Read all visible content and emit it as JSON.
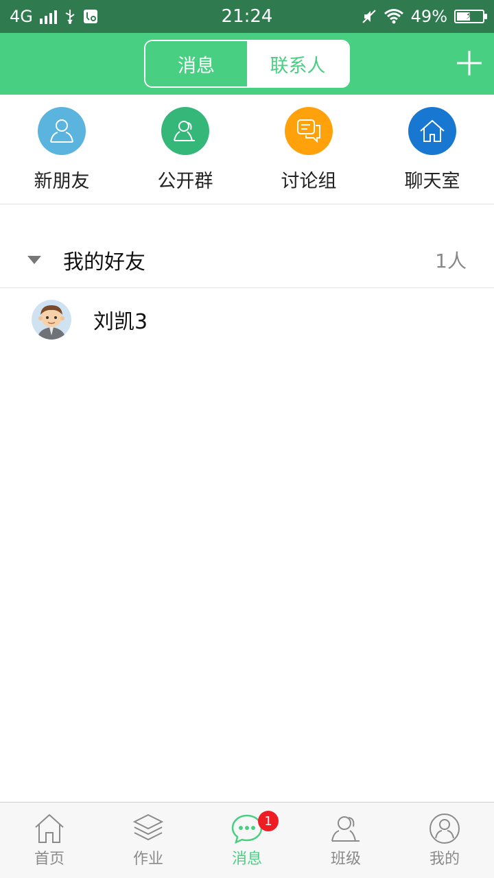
{
  "status_bar": {
    "network": "4G",
    "time": "21:24",
    "battery": "49%"
  },
  "header": {
    "tabs": [
      {
        "label": "消息",
        "selected": false
      },
      {
        "label": "联系人",
        "selected": true
      }
    ],
    "add_icon": "plus-icon"
  },
  "quick_entries": [
    {
      "label": "新朋友",
      "icon": "new-friend-icon",
      "color": "#5bb4de"
    },
    {
      "label": "公开群",
      "icon": "public-group-icon",
      "color": "#35b77a"
    },
    {
      "label": "讨论组",
      "icon": "discussion-icon",
      "color": "#ffa10a"
    },
    {
      "label": "聊天室",
      "icon": "home-icon",
      "color": "#1877d1"
    }
  ],
  "friends_group": {
    "title": "我的好友",
    "count": "1人",
    "expanded": true
  },
  "contacts": [
    {
      "name": "刘凯3"
    }
  ],
  "bottom_nav": [
    {
      "label": "首页",
      "icon": "home-icon",
      "active": false
    },
    {
      "label": "作业",
      "icon": "layers-icon",
      "active": false
    },
    {
      "label": "消息",
      "icon": "chat-bubble-icon",
      "active": true,
      "badge": "1"
    },
    {
      "label": "班级",
      "icon": "class-people-icon",
      "active": false
    },
    {
      "label": "我的",
      "icon": "profile-icon",
      "active": false
    }
  ],
  "colors": {
    "primary": "#49cf82",
    "status_bar": "#2f7a4e",
    "badge": "#ee1d23"
  }
}
